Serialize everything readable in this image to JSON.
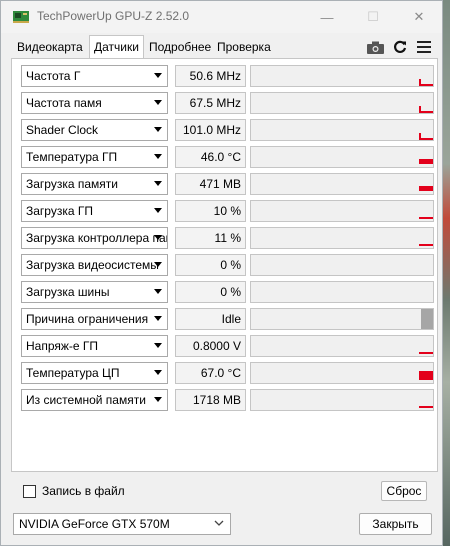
{
  "window": {
    "title": "TechPowerUp GPU-Z 2.52.0",
    "controls": {
      "minimize": "—",
      "maximize": "☐",
      "close": "✕"
    }
  },
  "tabs": [
    {
      "label": "Видеокарта",
      "active": false
    },
    {
      "label": "Датчики",
      "active": true
    },
    {
      "label": "Подробнее",
      "active": false
    },
    {
      "label": "Проверка",
      "active": false
    }
  ],
  "toolbar_icons": [
    "camera-icon",
    "refresh-icon",
    "menu-icon"
  ],
  "sensors": [
    {
      "name": "Частота Г",
      "value": "50.6 MHz",
      "graph_level": 0.35,
      "graph_style": "spike"
    },
    {
      "name": "Частота памя",
      "value": "67.5 MHz",
      "graph_level": 0.35,
      "graph_style": "spike"
    },
    {
      "name": "Shader Clock",
      "value": "101.0 MHz",
      "graph_level": 0.35,
      "graph_style": "spike"
    },
    {
      "name": "Температура ГП",
      "value": "46.0 °C",
      "graph_level": 0.25,
      "graph_style": "block"
    },
    {
      "name": "Загрузка памяти",
      "value": "471 MB",
      "graph_level": 0.25,
      "graph_style": "block"
    },
    {
      "name": "Загрузка ГП",
      "value": "10 %",
      "graph_level": 0.1,
      "graph_style": "line"
    },
    {
      "name": "Загрузка контроллера памяти",
      "value": "11 %",
      "graph_level": 0.1,
      "graph_style": "line"
    },
    {
      "name": "Загрузка видеосистемы",
      "value": "0 %",
      "graph_level": 0,
      "graph_style": "none"
    },
    {
      "name": "Загрузка шины",
      "value": "0 %",
      "graph_level": 0,
      "graph_style": "none"
    },
    {
      "name": "Причина ограничения",
      "value": "Idle",
      "graph_level": 1,
      "graph_style": "gray"
    },
    {
      "name": "Напряж-е ГП",
      "value": "0.8000 V",
      "graph_level": 0.1,
      "graph_style": "line"
    },
    {
      "name": "Температура ЦП",
      "value": "67.0 °C",
      "graph_level": 0.45,
      "graph_style": "block"
    },
    {
      "name": "Из системной памяти",
      "value": "1718 MB",
      "graph_level": 0.1,
      "graph_style": "line"
    }
  ],
  "footer": {
    "log_label": "Запись в файл",
    "log_checked": false,
    "reset_label": "Сброс",
    "gpu_selected": "NVIDIA GeForce GTX 570M",
    "close_label": "Закрыть"
  },
  "colors": {
    "graph": "#e3001b",
    "limit_gray": "#a6a6a6"
  }
}
